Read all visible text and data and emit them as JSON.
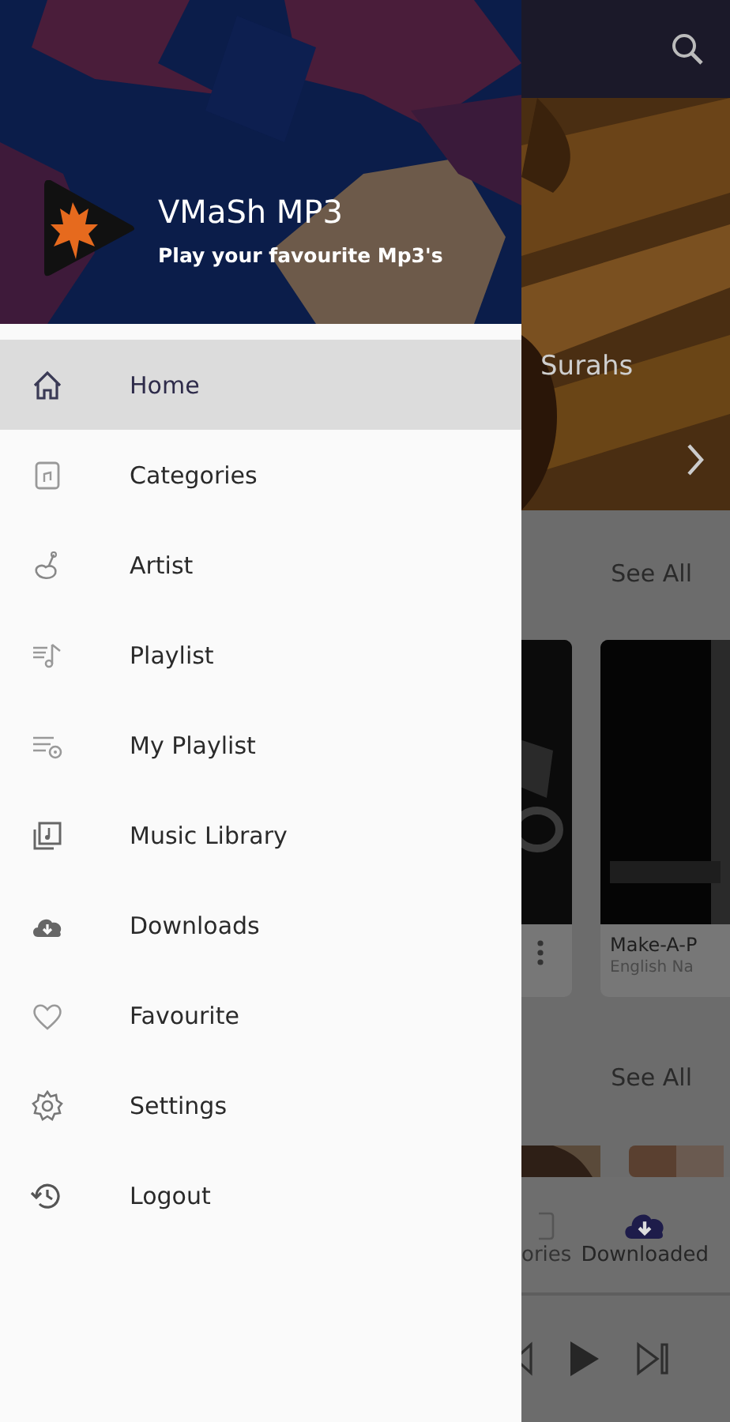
{
  "drawer": {
    "app_name": "VMaSh MP3",
    "tagline": "Play your favourite Mp3's",
    "items": [
      {
        "label": "Home",
        "selected": true
      },
      {
        "label": "Categories",
        "selected": false
      },
      {
        "label": "Artist",
        "selected": false
      },
      {
        "label": "Playlist",
        "selected": false
      },
      {
        "label": "My Playlist",
        "selected": false
      },
      {
        "label": "Music Library",
        "selected": false
      },
      {
        "label": "Downloads",
        "selected": false
      },
      {
        "label": "Favourite",
        "selected": false
      },
      {
        "label": "Settings",
        "selected": false
      },
      {
        "label": "Logout",
        "selected": false
      }
    ]
  },
  "background": {
    "banner_title": "Surahs",
    "sections": [
      {
        "see_all": "See All"
      },
      {
        "see_all": "See All"
      }
    ],
    "card": {
      "title": "Make-A-P",
      "subtitle": "English Na"
    },
    "bottom_nav": [
      {
        "label": "ories",
        "selected": false
      },
      {
        "label": "Downloaded",
        "selected": true
      }
    ]
  }
}
